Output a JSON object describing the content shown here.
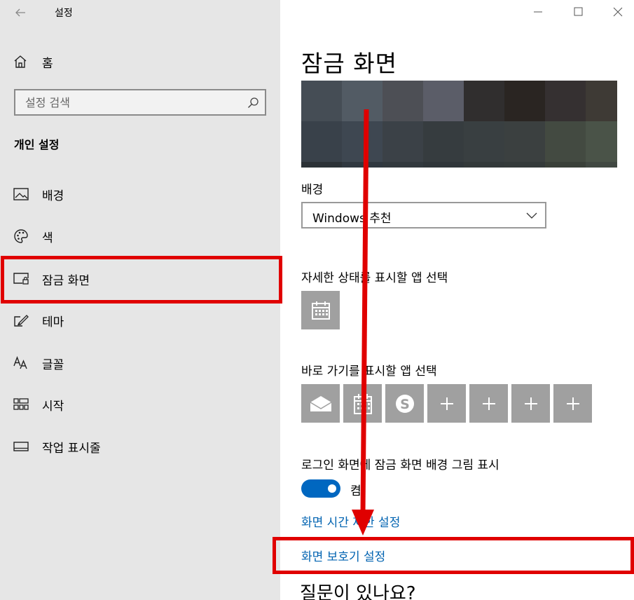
{
  "window": {
    "title": "설정"
  },
  "sidebar": {
    "home_label": "홈",
    "search_placeholder": "설정 검색",
    "section_title": "개인 설정",
    "items": [
      {
        "label": "배경",
        "icon": "picture-icon"
      },
      {
        "label": "색",
        "icon": "palette-icon"
      },
      {
        "label": "잠금 화면",
        "icon": "lock-screen-icon",
        "selected": true
      },
      {
        "label": "테마",
        "icon": "theme-brush-icon"
      },
      {
        "label": "글꼴",
        "icon": "font-icon"
      },
      {
        "label": "시작",
        "icon": "start-grid-icon"
      },
      {
        "label": "작업 표시줄",
        "icon": "taskbar-icon"
      }
    ]
  },
  "main": {
    "title": "잠금 화면",
    "background_label": "배경",
    "background_value": "Windows 추천",
    "detail_app_label": "자세한 상태를 표시할 앱 선택",
    "quick_app_label": "바로 가기를 표시할 앱 선택",
    "quick_apps": [
      "mail-icon",
      "calendar-icon",
      "skype-icon",
      "plus-icon",
      "plus-icon",
      "plus-icon",
      "plus-icon"
    ],
    "login_bg_label": "로그인 화면에 잠금 화면 배경 그림 표시",
    "login_bg_toggle": "켬",
    "link_timeout": "화면 시간 제한 설정",
    "link_screensaver": "화면 보호기 설정",
    "question": "질문이 있나요?"
  },
  "colors": {
    "accent": "#0067c0",
    "link": "#0063b1",
    "highlight": "#e00000",
    "sidebar_bg": "#e6e6e6",
    "tile_bg": "#a0a0a0"
  }
}
